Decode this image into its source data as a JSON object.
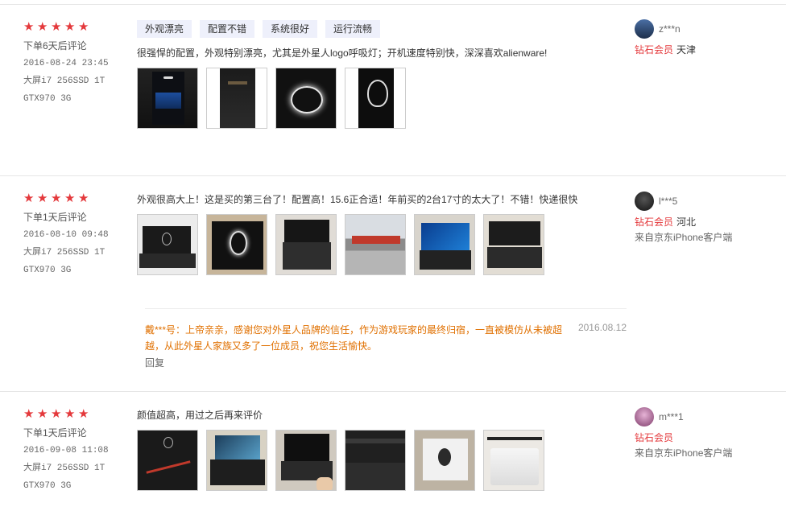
{
  "reviews": [
    {
      "rating": 5,
      "order_info": "下单6天后评论",
      "date": "2016-08-24 23:45",
      "spec1": "大屏i7 256SSD 1T",
      "spec2": "GTX970 3G",
      "tags": [
        "外观漂亮",
        "配置不错",
        "系统很好",
        "运行流畅"
      ],
      "content": "很强悍的配置，外观特别漂亮，尤其是外星人logo呼吸灯；开机速度特别快，深深喜欢alienware!",
      "images": [
        "laptop-blue-keyboard-photo",
        "laptop-lid-photo",
        "alien-logo-glow-photo",
        "alien-head-logo-photo"
      ],
      "user": {
        "name": "z***n",
        "level": "钻石会员",
        "region": "天津",
        "from": ""
      }
    },
    {
      "rating": 5,
      "order_info": "下单1天后评论",
      "date": "2016-08-10 09:48",
      "spec1": "大屏i7 256SSD 1T",
      "spec2": "GTX970 3G",
      "tags": [],
      "content": "外观很高大上！这是买的第三台了！配置高！15.6正合适！年前买的2台17寸的太大了！不错！快递很快",
      "images": [
        "laptop-open-desk-photo",
        "alien-box-photo",
        "laptop-keyboard-top-photo",
        "outdoor-building-photo",
        "laptop-windows-screen-photo",
        "laptop-closed-photo"
      ],
      "user": {
        "name": "l***5",
        "level": "钻石会员",
        "region": "河北",
        "from": "来自京东iPhone客户端"
      },
      "reply": {
        "text": "戴***号：上帝亲亲，感谢您对外星人品牌的信任，作为游戏玩家的最终归宿，一直被模仿从未被超越，从此外星人家族又多了一位成员，祝您生活愉快。",
        "date": "2016.08.12",
        "button": "回复"
      }
    },
    {
      "rating": 5,
      "order_info": "下单1天后评论",
      "date": "2016-09-08 11:08",
      "spec1": "大屏i7 256SSD 1T",
      "spec2": "GTX970 3G",
      "tags": [],
      "content": "颜值超高，用过之后再来评价",
      "images": [
        "laptop-lid-red-photo",
        "laptop-on-box-photo",
        "laptop-dark-screen-photo",
        "laptop-back-vents-photo",
        "box-on-carpet-photo",
        "laptop-silver-lid-photo"
      ],
      "user": {
        "name": "m***1",
        "level": "钻石会员",
        "region": "",
        "from": "来自京东iPhone客户端"
      }
    }
  ],
  "colors": {
    "accent": "#e4393c",
    "reply": "#e07000",
    "tag_bg": "#eef0fb"
  }
}
